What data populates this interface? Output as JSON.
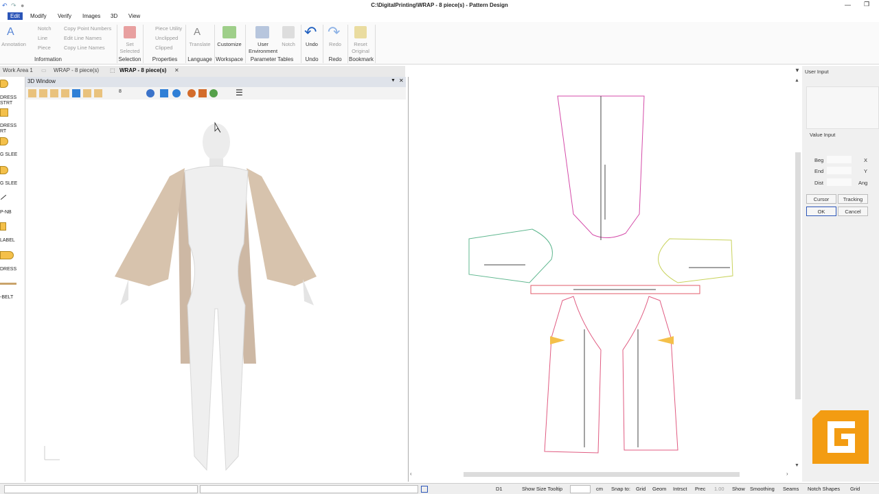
{
  "window": {
    "title": "C:\\DigitalPrinting\\WRAP - 8 piece(s) - Pattern Design"
  },
  "menu": [
    "Edit",
    "Modify",
    "Verify",
    "Images",
    "3D",
    "View"
  ],
  "ribbon": {
    "annotation": "Annotation",
    "notch_small": "Notch",
    "line_small": "Line",
    "piece_small": "Piece",
    "copy_point_numbers": "Copy Point Numbers",
    "edit_line_names": "Edit Line Names",
    "copy_line_names": "Copy Line Names",
    "set_selected": [
      "Set",
      "Selected"
    ],
    "piece_utility": "Piece Utility",
    "unclipped": "Unclipped",
    "clipped": "Clipped",
    "translate": "Translate",
    "customize": "Customize",
    "user_environment": [
      "User",
      "Environment"
    ],
    "notch": "Notch",
    "undo": "Undo",
    "redo": "Redo",
    "reset_original": [
      "Reset",
      "Original"
    ],
    "groups": [
      "Information",
      "Selection",
      "Properties",
      "Language",
      "Workspace",
      "Parameter Tables",
      "Undo",
      "Redo",
      "Bookmark"
    ]
  },
  "tabs": [
    "Work Area 1",
    "WRAP - 8 piece(s)",
    "WRAP - 8 piece(s)"
  ],
  "left_pieces": [
    "DRESS",
    "STRT",
    "DRESS",
    "RT",
    "G SLEE",
    "G SLEE",
    "P-NB",
    "LABEL",
    "DRESS",
    "-BELT"
  ],
  "window3d": {
    "title": "3D Window",
    "toolbar_value": "8"
  },
  "user_input": {
    "title": "User Input",
    "value_input": "Value Input",
    "beg": "Beg",
    "end": "End",
    "dist": "Dist",
    "x": "X",
    "y": "Y",
    "ang": "Ang",
    "cursor": "Cursor",
    "tracking": "Tracking",
    "ok": "OK",
    "cancel": "Cancel"
  },
  "status": {
    "d1": "D1",
    "show_size_tooltip": "Show Size Tooltip",
    "unit": "cm",
    "snap_to": "Snap to:",
    "grid": "Grid",
    "geom": "Geom",
    "intrsct": "Intrsct",
    "prec": "Prec",
    "prec_value": "1.00",
    "show": "Show",
    "smoothing": "Smoothing",
    "seams": "Seams",
    "notch_shapes": "Notch Shapes",
    "grid2": "Grid"
  },
  "colors": {
    "accent": "#2b55b8",
    "brand": "#f39c12",
    "piece_fill": "#f4c04a"
  }
}
